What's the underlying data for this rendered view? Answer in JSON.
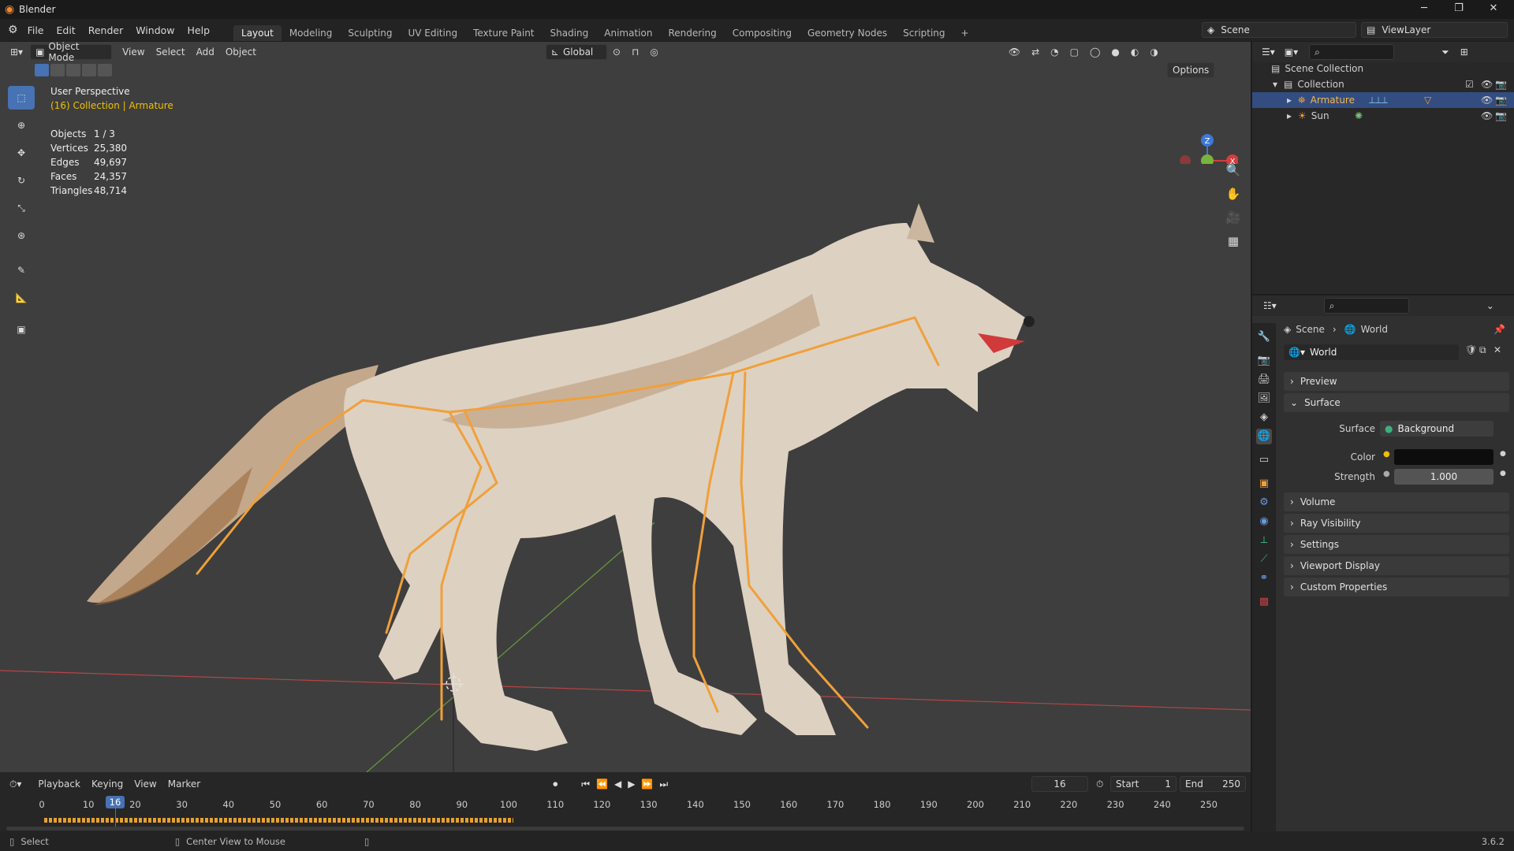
{
  "app_title": "Blender",
  "menus": [
    "File",
    "Edit",
    "Render",
    "Window",
    "Help"
  ],
  "workspaces": [
    "Layout",
    "Modeling",
    "Sculpting",
    "UV Editing",
    "Texture Paint",
    "Shading",
    "Animation",
    "Rendering",
    "Compositing",
    "Geometry Nodes",
    "Scripting"
  ],
  "active_workspace": "Layout",
  "scene_name": "Scene",
  "view_layer": "ViewLayer",
  "viewport": {
    "mode": "Object Mode",
    "menus": [
      "View",
      "Select",
      "Add",
      "Object"
    ],
    "orientation": "Global",
    "options_label": "Options",
    "perspective": "User Perspective",
    "collection_info": "(16) Collection | Armature",
    "stats": [
      {
        "k": "Objects",
        "v": "1 / 3"
      },
      {
        "k": "Vertices",
        "v": "25,380"
      },
      {
        "k": "Edges",
        "v": "49,697"
      },
      {
        "k": "Faces",
        "v": "24,357"
      },
      {
        "k": "Triangles",
        "v": "48,714"
      }
    ],
    "gizmo": {
      "z": "Z",
      "x": "X"
    }
  },
  "outliner": {
    "root": "Scene Collection",
    "collection": "Collection",
    "items": [
      "Armature",
      "Sun"
    ]
  },
  "properties": {
    "breadcrumb": [
      "Scene",
      "World"
    ],
    "world_name": "World",
    "panels": {
      "preview": "Preview",
      "surface": "Surface",
      "volume": "Volume",
      "ray": "Ray Visibility",
      "settings": "Settings",
      "viewport_display": "Viewport Display",
      "custom": "Custom Properties"
    },
    "surface_label": "Surface",
    "surface_value": "Background",
    "color_label": "Color",
    "strength_label": "Strength",
    "strength_value": "1.000"
  },
  "timeline": {
    "menus": [
      "Playback",
      "Keying",
      "View",
      "Marker"
    ],
    "current_frame": "16",
    "start_label": "Start",
    "start": "1",
    "end_label": "End",
    "end": "250",
    "ticks": [
      "0",
      "10",
      "20",
      "30",
      "40",
      "50",
      "60",
      "70",
      "80",
      "90",
      "100",
      "110",
      "120",
      "130",
      "140",
      "150",
      "160",
      "170",
      "180",
      "190",
      "200",
      "210",
      "220",
      "230",
      "240",
      "250"
    ]
  },
  "status": {
    "left": "Select",
    "middle": "Center View to Mouse",
    "version": "3.6.2"
  },
  "colors": {
    "accent": "#4772b3",
    "bone": "#f0a03a",
    "x_axis": "#d63c3c",
    "y_axis": "#7ab33c",
    "z_axis": "#3c78d6"
  }
}
